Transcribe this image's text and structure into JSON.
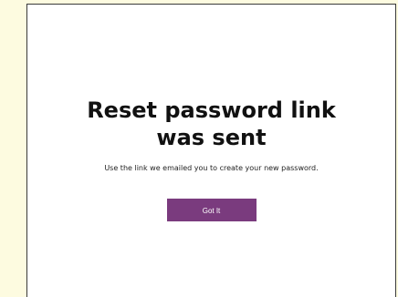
{
  "dialog": {
    "title": "Reset password link was sent",
    "message": "Use the link we emailed you to create your new password.",
    "button_label": "Got It"
  },
  "colors": {
    "page_background": "#fdfbe0",
    "panel_background": "#ffffff",
    "button_background": "#7a3b7e",
    "button_text": "#ffffff"
  }
}
